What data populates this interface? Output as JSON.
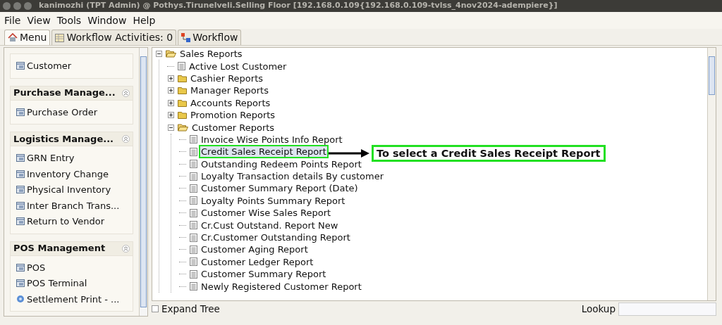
{
  "window": {
    "title": "kanimozhi (TPT Admin) @ Pothys.Tirunelveli.Selling Floor [192.168.0.109{192.168.0.109-tvlss_4nov2024-adempiere}]"
  },
  "menu_bar": [
    {
      "label": "File"
    },
    {
      "label": "View"
    },
    {
      "label": "Tools"
    },
    {
      "label": "Window"
    },
    {
      "label": "Help"
    }
  ],
  "tabs": [
    {
      "label": "Menu",
      "kind": "home",
      "selected": true
    },
    {
      "label": "Workflow Activities: 0",
      "kind": "list",
      "selected": false
    },
    {
      "label": "Workflow",
      "kind": "flow",
      "selected": false
    }
  ],
  "sidebar": {
    "sections": [
      {
        "items": [
          {
            "label": "Customer",
            "kind": "window"
          }
        ]
      },
      {
        "title": "Purchase Manage...",
        "items": [
          {
            "label": "Purchase Order",
            "kind": "window"
          }
        ]
      },
      {
        "title": "Logistics Manage...",
        "items": [
          {
            "label": "GRN Entry",
            "kind": "window"
          },
          {
            "label": "Inventory Change",
            "kind": "window"
          },
          {
            "label": "Physical Inventory",
            "kind": "window"
          },
          {
            "label": "Inter Branch Trans...",
            "kind": "window"
          },
          {
            "label": "Return to Vendor",
            "kind": "window"
          }
        ]
      },
      {
        "title": "POS Management",
        "items": [
          {
            "label": "POS",
            "kind": "window"
          },
          {
            "label": "POS Terminal",
            "kind": "window"
          },
          {
            "label": "Settlement Print - ...",
            "kind": "process"
          }
        ]
      }
    ]
  },
  "tree": [
    {
      "label": "Sales Reports",
      "kind": "folder",
      "expanded": true,
      "selected": false,
      "children": [
        {
          "label": "Active Lost Customer",
          "kind": "report",
          "selected": false
        },
        {
          "label": "Cashier Reports",
          "kind": "folder",
          "expanded": false,
          "selected": false
        },
        {
          "label": "Manager Reports",
          "kind": "folder",
          "expanded": false,
          "selected": false
        },
        {
          "label": "Accounts Reports",
          "kind": "folder",
          "expanded": false,
          "selected": false
        },
        {
          "label": "Promotion Reports",
          "kind": "folder",
          "expanded": false,
          "selected": false
        },
        {
          "label": "Customer Reports",
          "kind": "folder",
          "expanded": true,
          "selected": false,
          "children": [
            {
              "label": "Invoice Wise Points Info Report",
              "kind": "report",
              "selected": false
            },
            {
              "label": "Credit Sales Receipt Report",
              "kind": "report",
              "selected": true
            },
            {
              "label": "Outstanding Redeem Points Report",
              "kind": "report",
              "selected": false
            },
            {
              "label": "Loyalty Transaction details By customer",
              "kind": "report",
              "selected": false
            },
            {
              "label": "Customer Summary Report (Date)",
              "kind": "report",
              "selected": false
            },
            {
              "label": "Loyalty Points Summary Report",
              "kind": "report",
              "selected": false
            },
            {
              "label": "Customer Wise Sales Report",
              "kind": "report",
              "selected": false
            },
            {
              "label": "Cr.Cust Outstand. Report New",
              "kind": "report",
              "selected": false
            },
            {
              "label": "Cr.Customer Outstanding Report",
              "kind": "report",
              "selected": false
            },
            {
              "label": "Customer Aging Report",
              "kind": "report",
              "selected": false
            },
            {
              "label": "Customer Ledger Report",
              "kind": "report",
              "selected": false
            },
            {
              "label": "Customer Summary Report",
              "kind": "report",
              "selected": false
            },
            {
              "label": "Newly Registered Customer Report",
              "kind": "report",
              "selected": false
            }
          ]
        }
      ]
    }
  ],
  "annotation": {
    "text": "To select a Credit Sales Receipt Report"
  },
  "footer": {
    "expand_tree": {
      "label": "Expand Tree",
      "checked": false
    },
    "lookup": {
      "label": "Lookup"
    }
  }
}
